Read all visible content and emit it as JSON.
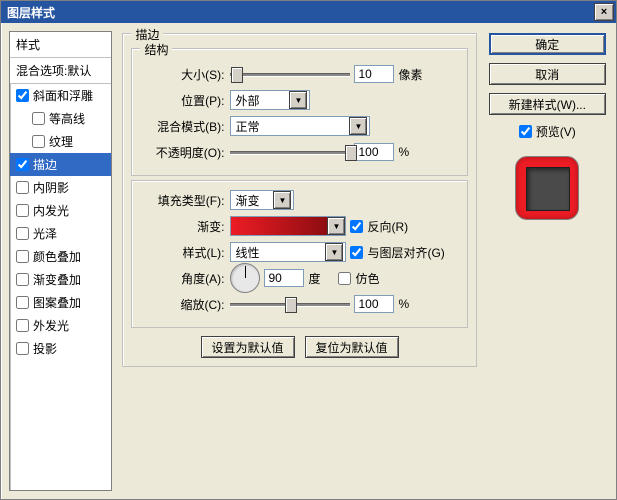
{
  "window": {
    "title": "图层样式",
    "close_glyph": "×"
  },
  "left": {
    "styles_header": "样式",
    "blend_header": "混合选项:默认",
    "items": [
      {
        "label": "斜面和浮雕",
        "checked": true,
        "indent": false
      },
      {
        "label": "等高线",
        "checked": false,
        "indent": true
      },
      {
        "label": "纹理",
        "checked": false,
        "indent": true
      },
      {
        "label": "描边",
        "checked": true,
        "indent": false,
        "selected": true
      },
      {
        "label": "内阴影",
        "checked": false,
        "indent": false
      },
      {
        "label": "内发光",
        "checked": false,
        "indent": false
      },
      {
        "label": "光泽",
        "checked": false,
        "indent": false
      },
      {
        "label": "颜色叠加",
        "checked": false,
        "indent": false
      },
      {
        "label": "渐变叠加",
        "checked": false,
        "indent": false
      },
      {
        "label": "图案叠加",
        "checked": false,
        "indent": false
      },
      {
        "label": "外发光",
        "checked": false,
        "indent": false
      },
      {
        "label": "投影",
        "checked": false,
        "indent": false
      }
    ]
  },
  "main": {
    "outer_legend": "描边",
    "structure_legend": "结构",
    "size_label": "大小(S):",
    "size_value": "10",
    "size_unit": "像素",
    "position_label": "位置(P):",
    "position_value": "外部",
    "blendmode_label": "混合模式(B):",
    "blendmode_value": "正常",
    "opacity_label": "不透明度(O):",
    "opacity_value": "100",
    "opacity_unit": "%",
    "filltype_label": "填充类型(F):",
    "filltype_value": "渐变",
    "gradient_label": "渐变:",
    "reverse_label": "反向(R)",
    "style_label": "样式(L):",
    "style_value": "线性",
    "align_label": "与图层对齐(G)",
    "angle_label": "角度(A):",
    "angle_value": "90",
    "angle_unit": "度",
    "dither_label": "仿色",
    "scale_label": "缩放(C):",
    "scale_value": "100",
    "scale_unit": "%",
    "make_default_btn": "设置为默认值",
    "reset_default_btn": "复位为默认值"
  },
  "right": {
    "ok": "确定",
    "cancel": "取消",
    "new_style": "新建样式(W)...",
    "preview_label": "预览(V)"
  }
}
